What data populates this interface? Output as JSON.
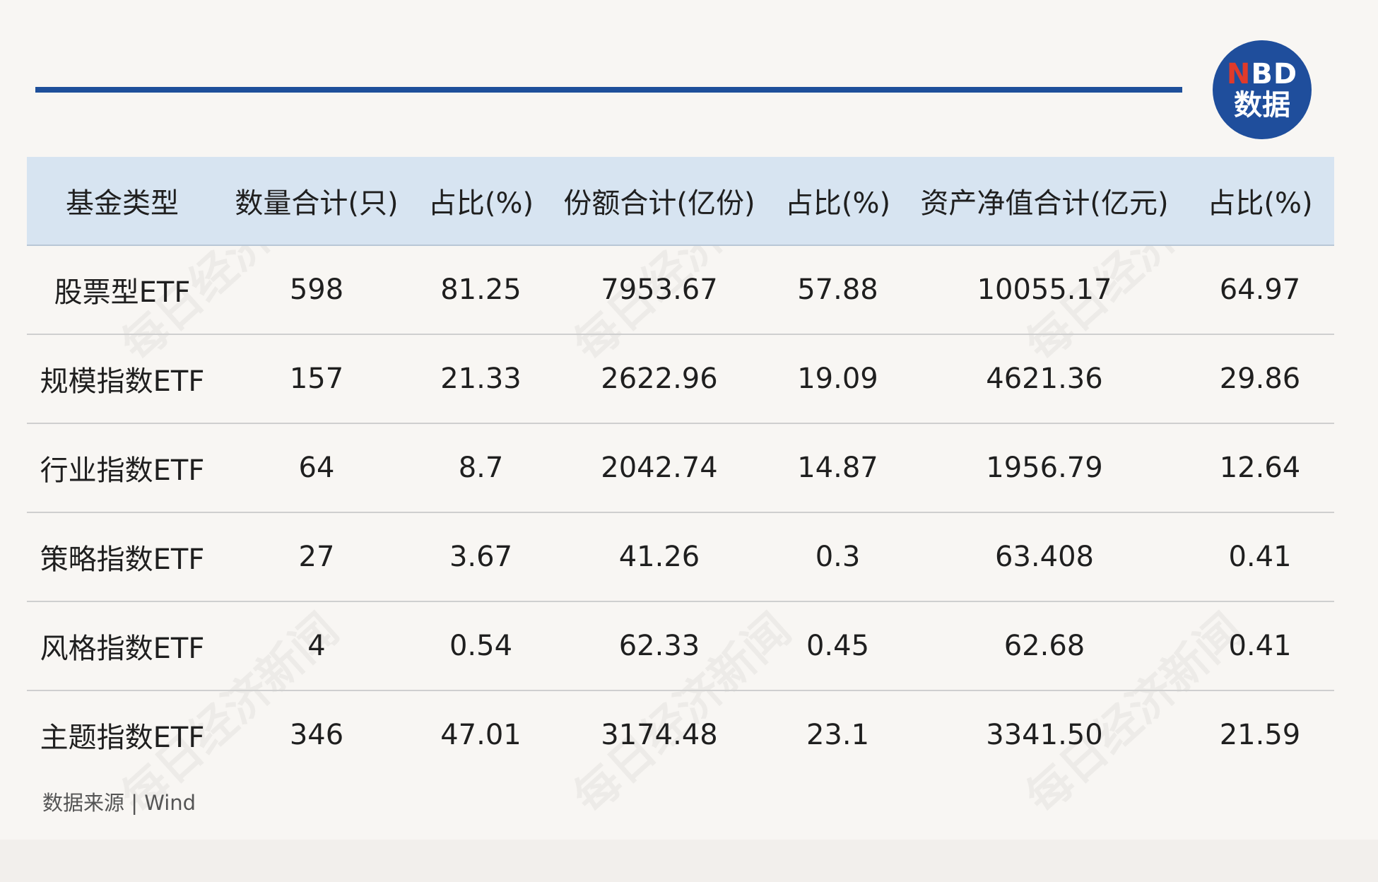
{
  "logo": {
    "line1_n": "N",
    "line1_rest": "BD",
    "line2": "数据"
  },
  "table": {
    "headers": [
      "基金类型",
      "数量合计(只)",
      "占比(%)",
      "份额合计(亿份)",
      "占比(%)",
      "资产净值合计(亿元)",
      "占比(%)"
    ],
    "rows": [
      [
        "股票型ETF",
        "598",
        "81.25",
        "7953.67",
        "57.88",
        "10055.17",
        "64.97"
      ],
      [
        "规模指数ETF",
        "157",
        "21.33",
        "2622.96",
        "19.09",
        "4621.36",
        "29.86"
      ],
      [
        "行业指数ETF",
        "64",
        "8.7",
        "2042.74",
        "14.87",
        "1956.79",
        "12.64"
      ],
      [
        "策略指数ETF",
        "27",
        "3.67",
        "41.26",
        "0.3",
        "63.408",
        "0.41"
      ],
      [
        "风格指数ETF",
        "4",
        "0.54",
        "62.33",
        "0.45",
        "62.68",
        "0.41"
      ],
      [
        "主题指数ETF",
        "346",
        "47.01",
        "3174.48",
        "23.1",
        "3341.50",
        "21.59"
      ]
    ]
  },
  "source": "数据来源 | Wind",
  "watermark": "每日经济新闻",
  "colors": {
    "accent": "#1e4f9a",
    "header_bg": "#d7e4f1",
    "logo_red": "#e03a2a"
  }
}
